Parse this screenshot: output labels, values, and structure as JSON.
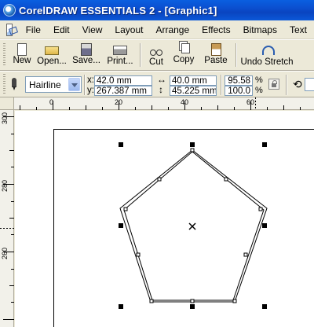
{
  "window": {
    "title": "CorelDRAW ESSENTIALS 2 - [Graphic1]"
  },
  "menu": {
    "items": [
      "File",
      "Edit",
      "View",
      "Layout",
      "Arrange",
      "Effects",
      "Bitmaps",
      "Text"
    ]
  },
  "toolbar": {
    "new_label": "New",
    "open_label": "Open...",
    "save_label": "Save...",
    "print_label": "Print...",
    "cut_label": "Cut",
    "copy_label": "Copy",
    "paste_label": "Paste",
    "undo_label": "Undo Stretch"
  },
  "property_bar": {
    "outline_width": "Hairline",
    "x_label": "x:",
    "y_label": "y:",
    "x_value": "42.0 mm",
    "y_value": "267.387 mm",
    "width_value": "40.0 mm",
    "height_value": "45.225 mm",
    "scale_x": "95.58",
    "scale_y": "100.0",
    "percent_symbol": "%"
  },
  "rulers": {
    "top_labels": [
      "0",
      "20",
      "40",
      "60"
    ],
    "left_labels": [
      "300",
      "280",
      "260"
    ]
  },
  "icons": {
    "app": "coreldraw-icon",
    "center": "center-cross-icon"
  }
}
